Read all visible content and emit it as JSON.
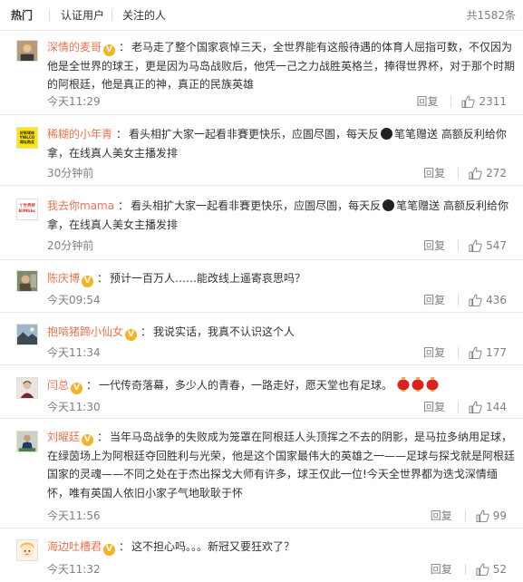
{
  "header": {
    "tabs": [
      {
        "label": "热门"
      },
      {
        "label": "认证用户"
      },
      {
        "label": "关注的人"
      }
    ],
    "total": "共1582条"
  },
  "colors": {
    "username": "#eb7350",
    "meta": "#808080",
    "verified_badge": "#f6b125"
  },
  "comments": [
    {
      "user": "深情的麦哥",
      "verified": true,
      "segments": [
        "老马走了整个国家哀悼三天，全世界能有这般待遇的体育人屈指可数，不仅因为他是全世界的球王，更是因为马岛战败后，他凭一己之力战胜英格兰，捧得世界杯，对于那个时期的阿根廷，他是真正的神，真正的民族英雄"
      ],
      "time": "今天11:29",
      "reply": "回复",
      "likes": "2311",
      "avatar_icon": "portrait-avatar"
    },
    {
      "user": "稀糊的小年青",
      "verified": false,
      "segments": [
        "看头相扩大家一起看非賽更快乐，应圄尽圄，每天反",
        "笔笔赠送 高额反利给你拿，在线真人美女主播发排"
      ],
      "time": "30分钟前",
      "reply": "回复",
      "likes": "272",
      "avatar_icon": "yellow-ad-avatar",
      "avatar_text": [
        "好彩球体",
        "YNILCO",
        "网址购买"
      ]
    },
    {
      "user": "我去你mama",
      "verified": false,
      "segments": [
        "看头相扩大家一起看非賽更快乐，应圄尽圄，每天反",
        "笔笔赠送 高额反利给你拿，在线真人美女主播发排"
      ],
      "time": "20分钟前",
      "reply": "回复",
      "likes": "547",
      "avatar_icon": "white-ad-avatar",
      "avatar_text": [
        "丫世界杯",
        "BIMbbc"
      ]
    },
    {
      "user": "陈庆博",
      "verified": true,
      "segments": [
        "预计一百万人……能改线上遥寄哀思吗？"
      ],
      "time": "今天09:54",
      "reply": "回复",
      "likes": "436",
      "avatar_icon": "photo-avatar"
    },
    {
      "user": "抱啃猪蹄小仙女",
      "verified": true,
      "segments": [
        "我说实话，我真不认识这个人"
      ],
      "time": "今天11:34",
      "reply": "回复",
      "likes": "177",
      "avatar_icon": "landscape-avatar"
    },
    {
      "user": "闫总",
      "verified": true,
      "segments": [
        "一代传奇落幕，多少人的青春，一路走好，愿天堂也有足球。"
      ],
      "time": "今天11:30",
      "reply": "回复",
      "likes": "144",
      "avatar_icon": "person-avatar"
    },
    {
      "user": "刘曜廷",
      "verified": true,
      "segments": [
        "当年马岛战争的失败成为笼罩在阿根廷人头顶挥之不去的阴影，是马拉多纳用足球，在绿茵场上为阿根廷夺回胜利与光荣，他是这个国家最伟大的英雄之一——足球与探戈就是阿根廷国家的灵魂——不同之处在于杰出探戈大师有许多，球王仅此一位!今天全世界都为迭戈深情缅怀，唯有英国人依旧小家子气地耿耿于怀"
      ],
      "time": "今天11:56",
      "reply": "回复",
      "likes": "99",
      "avatar_icon": "sport-avatar"
    },
    {
      "user": "海边吐槽君",
      "verified": true,
      "segments": [
        "这不担心吗。。。新冠又要狂欢了？"
      ],
      "time": "今天11:32",
      "reply": "回复",
      "likes": "52",
      "avatar_icon": "cartoon-avatar"
    }
  ]
}
